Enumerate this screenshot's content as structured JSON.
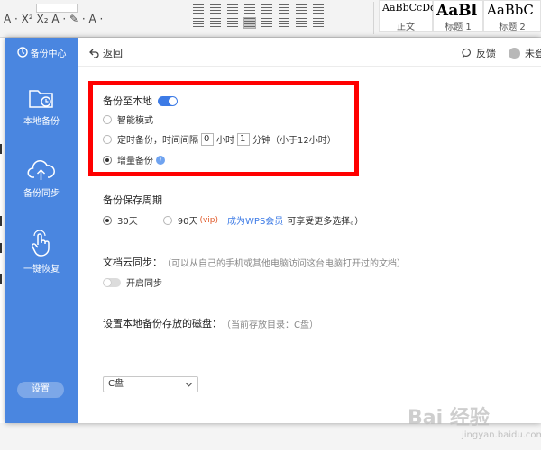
{
  "ribbon": {
    "font_row": "A · A⁻",
    "format_row": "A · X² X₂ A · ✎ · A ·",
    "paragraph_row": "",
    "styles": [
      {
        "sample": "AaBbCcDd",
        "name": "正文"
      },
      {
        "sample": "AaBl",
        "name": "标题 1"
      },
      {
        "sample": "AaBbC",
        "name": "标题 2"
      }
    ]
  },
  "sidebar": {
    "header": "备份中心",
    "items": [
      {
        "label": "本地备份",
        "icon": "folder-clock-icon"
      },
      {
        "label": "备份同步",
        "icon": "cloud-upload-icon"
      },
      {
        "label": "一键恢复",
        "icon": "hand-tap-icon"
      }
    ],
    "settings": "设置"
  },
  "topbar": {
    "back": "返回",
    "feedback": "反馈",
    "user": "未登"
  },
  "local_backup": {
    "title": "备份至本地",
    "enabled": true,
    "options": {
      "smart": "智能模式",
      "timed_prefix": "定时备份，时间间隔",
      "hours_value": "0",
      "hours_unit": "小时",
      "minutes_value": "1",
      "minutes_unit": "分钟（小于12小时）",
      "incremental": "增量备份"
    },
    "selected": "incremental"
  },
  "retention": {
    "title": "备份保存周期",
    "option_30": "30天",
    "option_90": "90天",
    "vip_tag": "(vip)",
    "member_link": "成为WPS会员",
    "member_suffix": "可享受更多选择。）",
    "selected": "30"
  },
  "cloud_sync": {
    "title": "文档云同步：",
    "hint": "（可以从自己的手机或其他电脑访问这台电脑打开过的文档）",
    "toggle_label": "开启同步",
    "enabled": false
  },
  "disk": {
    "title": "设置本地备份存放的磁盘：",
    "hint": "（当前存放目录：C盘）",
    "value": "C盘"
  },
  "watermark": {
    "main": "Bai 经验",
    "sub": "jingyan.baidu.com"
  },
  "colors": {
    "sidebar": "#4a86e0",
    "accent": "#3d7be6",
    "highlight_box": "#ff0000",
    "vip": "#e05a2a"
  }
}
